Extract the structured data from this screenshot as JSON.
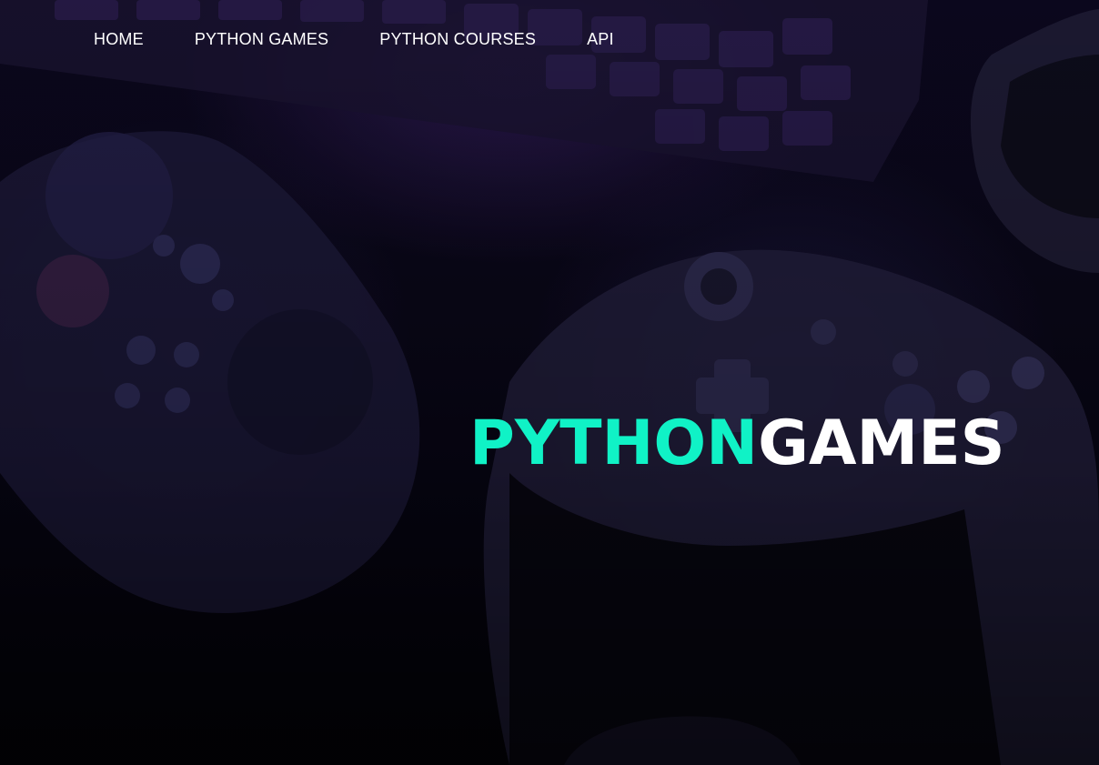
{
  "nav": {
    "items": [
      {
        "label": "HOME"
      },
      {
        "label": "PYTHON GAMES"
      },
      {
        "label": "PYTHON COURSES"
      },
      {
        "label": "API"
      }
    ]
  },
  "hero": {
    "title_part1": "PYTHON",
    "title_part2": "GAMES",
    "background_image": "game-controllers-keyboard-photo"
  },
  "colors": {
    "accent": "#10f2c6",
    "title_text": "#ffffff",
    "background": "#050310"
  }
}
